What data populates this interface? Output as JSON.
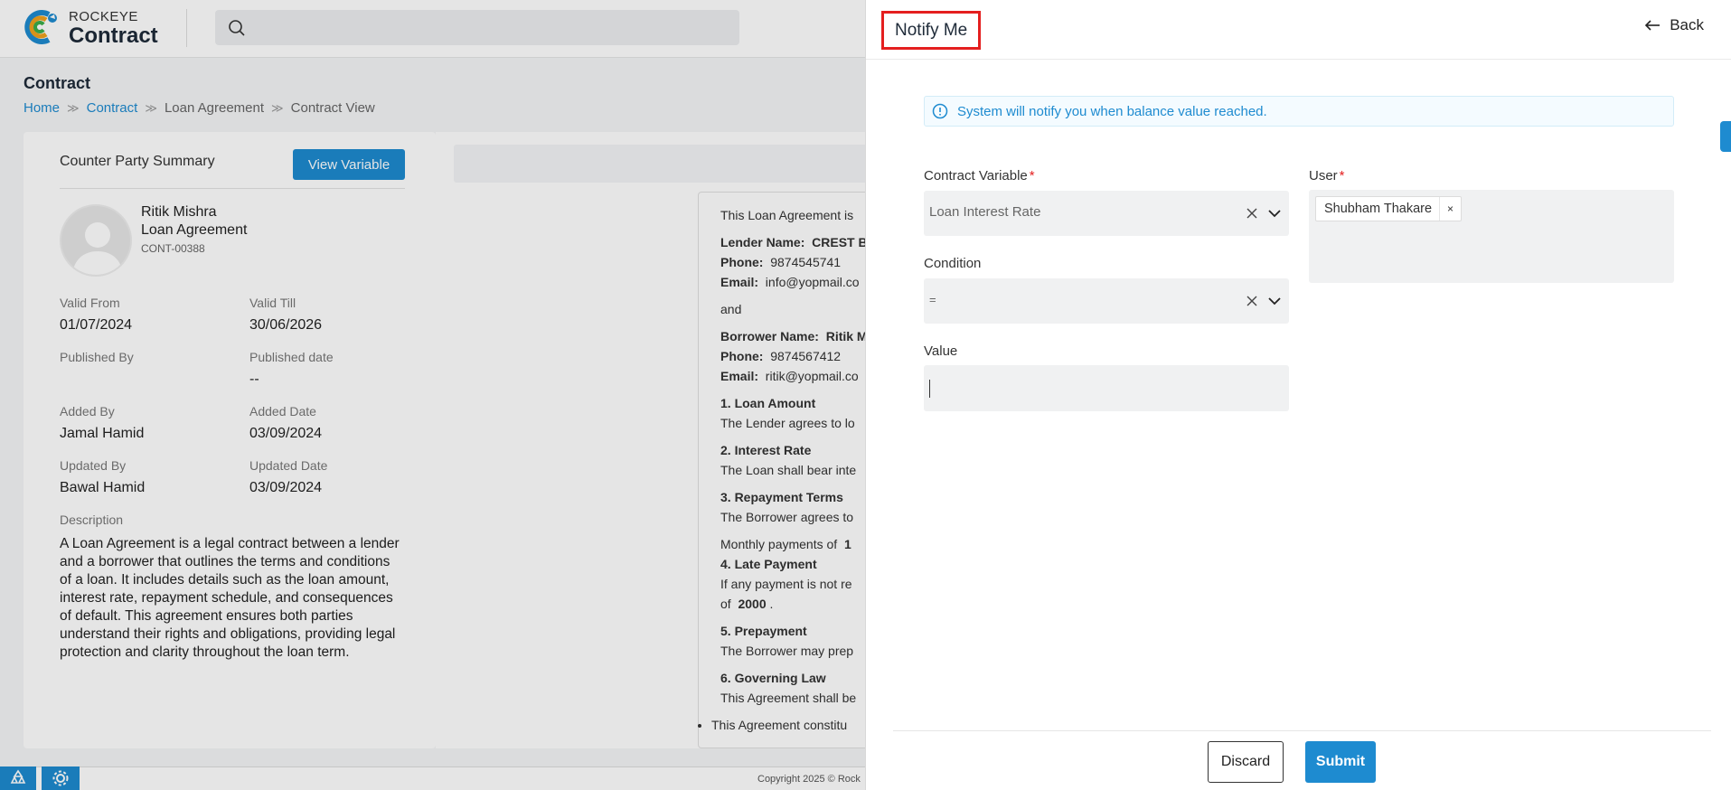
{
  "app": {
    "logo_small": "ROCKEYE",
    "logo_big": "Contract",
    "search_placeholder": ""
  },
  "page": {
    "title": "Contract",
    "breadcrumb": [
      "Home",
      "Contract",
      "Loan Agreement",
      "Contract View"
    ]
  },
  "summary": {
    "title": "Counter Party Summary",
    "view_variable_label": "View Variable",
    "party_name": "Ritik Mishra",
    "party_type": "Loan Agreement",
    "party_code": "CONT-00388",
    "valid_from_label": "Valid From",
    "valid_from": "01/07/2024",
    "valid_till_label": "Valid Till",
    "valid_till": "30/06/2026",
    "published_by_label": "Published By",
    "published_by": "",
    "published_date_label": "Published date",
    "published_date": "--",
    "added_by_label": "Added By",
    "added_by": "Jamal Hamid",
    "added_date_label": "Added Date",
    "added_date": "03/09/2024",
    "updated_by_label": "Updated By",
    "updated_by": "Bawal Hamid",
    "updated_date_label": "Updated Date",
    "updated_date": "03/09/2024",
    "description_label": "Description",
    "description": "A Loan Agreement is a legal contract between a lender and a borrower that outlines the terms and conditions of a loan. It includes details such as the loan amount, interest rate, repayment schedule, and consequences of default. This agreement ensures both parties understand their rights and obligations, providing legal protection and clarity throughout the loan term."
  },
  "contract": {
    "intro": "This Loan Agreement is",
    "lender_label": "Lender Name:",
    "lender_name": "CREST B",
    "lender_phone_label": "Phone:",
    "lender_phone": "9874545741",
    "lender_email_label": "Email:",
    "lender_email": "info@yopmail.co",
    "and": "and",
    "borrower_label": "Borrower Name:",
    "borrower_name": "Ritik M",
    "borrower_phone_label": "Phone:",
    "borrower_phone": "9874567412",
    "borrower_email_label": "Email:",
    "borrower_email": "ritik@yopmail.co",
    "s1_title": "1. Loan Amount",
    "s1_text": "The Lender agrees to lo",
    "s2_title": "2. Interest Rate",
    "s2_text": "The Loan shall bear inte",
    "s3_title": "3. Repayment Terms",
    "s3_text": "The Borrower agrees to",
    "s3_extra_label": "Monthly payments of",
    "s3_extra_value": "1",
    "s4_title": "4. Late Payment",
    "s4_text": "If any payment is not re",
    "s4_extra_label": "of",
    "s4_extra_value": "2000",
    "s4_extra_end": ".",
    "s5_title": "5. Prepayment",
    "s5_text": "The Borrower may prep",
    "s6_title": "6. Governing Law",
    "s6_text": "This Agreement shall be",
    "bullet": "This Agreement constitu"
  },
  "footer": {
    "copyright": "Copyright 2025 © Rock"
  },
  "drawer": {
    "title": "Notify Me",
    "back_label": "Back",
    "info": "System will notify you when balance value reached.",
    "contract_variable_label": "Contract Variable",
    "contract_variable_value": "Loan Interest Rate",
    "condition_label": "Condition",
    "condition_value": "=",
    "value_label": "Value",
    "value_input": "",
    "user_label": "User",
    "users": [
      "Shubham Thakare"
    ],
    "required_mark": "*",
    "chip_remove": "×",
    "discard_label": "Discard",
    "submit_label": "Submit"
  },
  "colors": {
    "accent": "#1e8bd0",
    "highlight_border": "#e41f1f",
    "field_bg": "#f0f1f2"
  }
}
